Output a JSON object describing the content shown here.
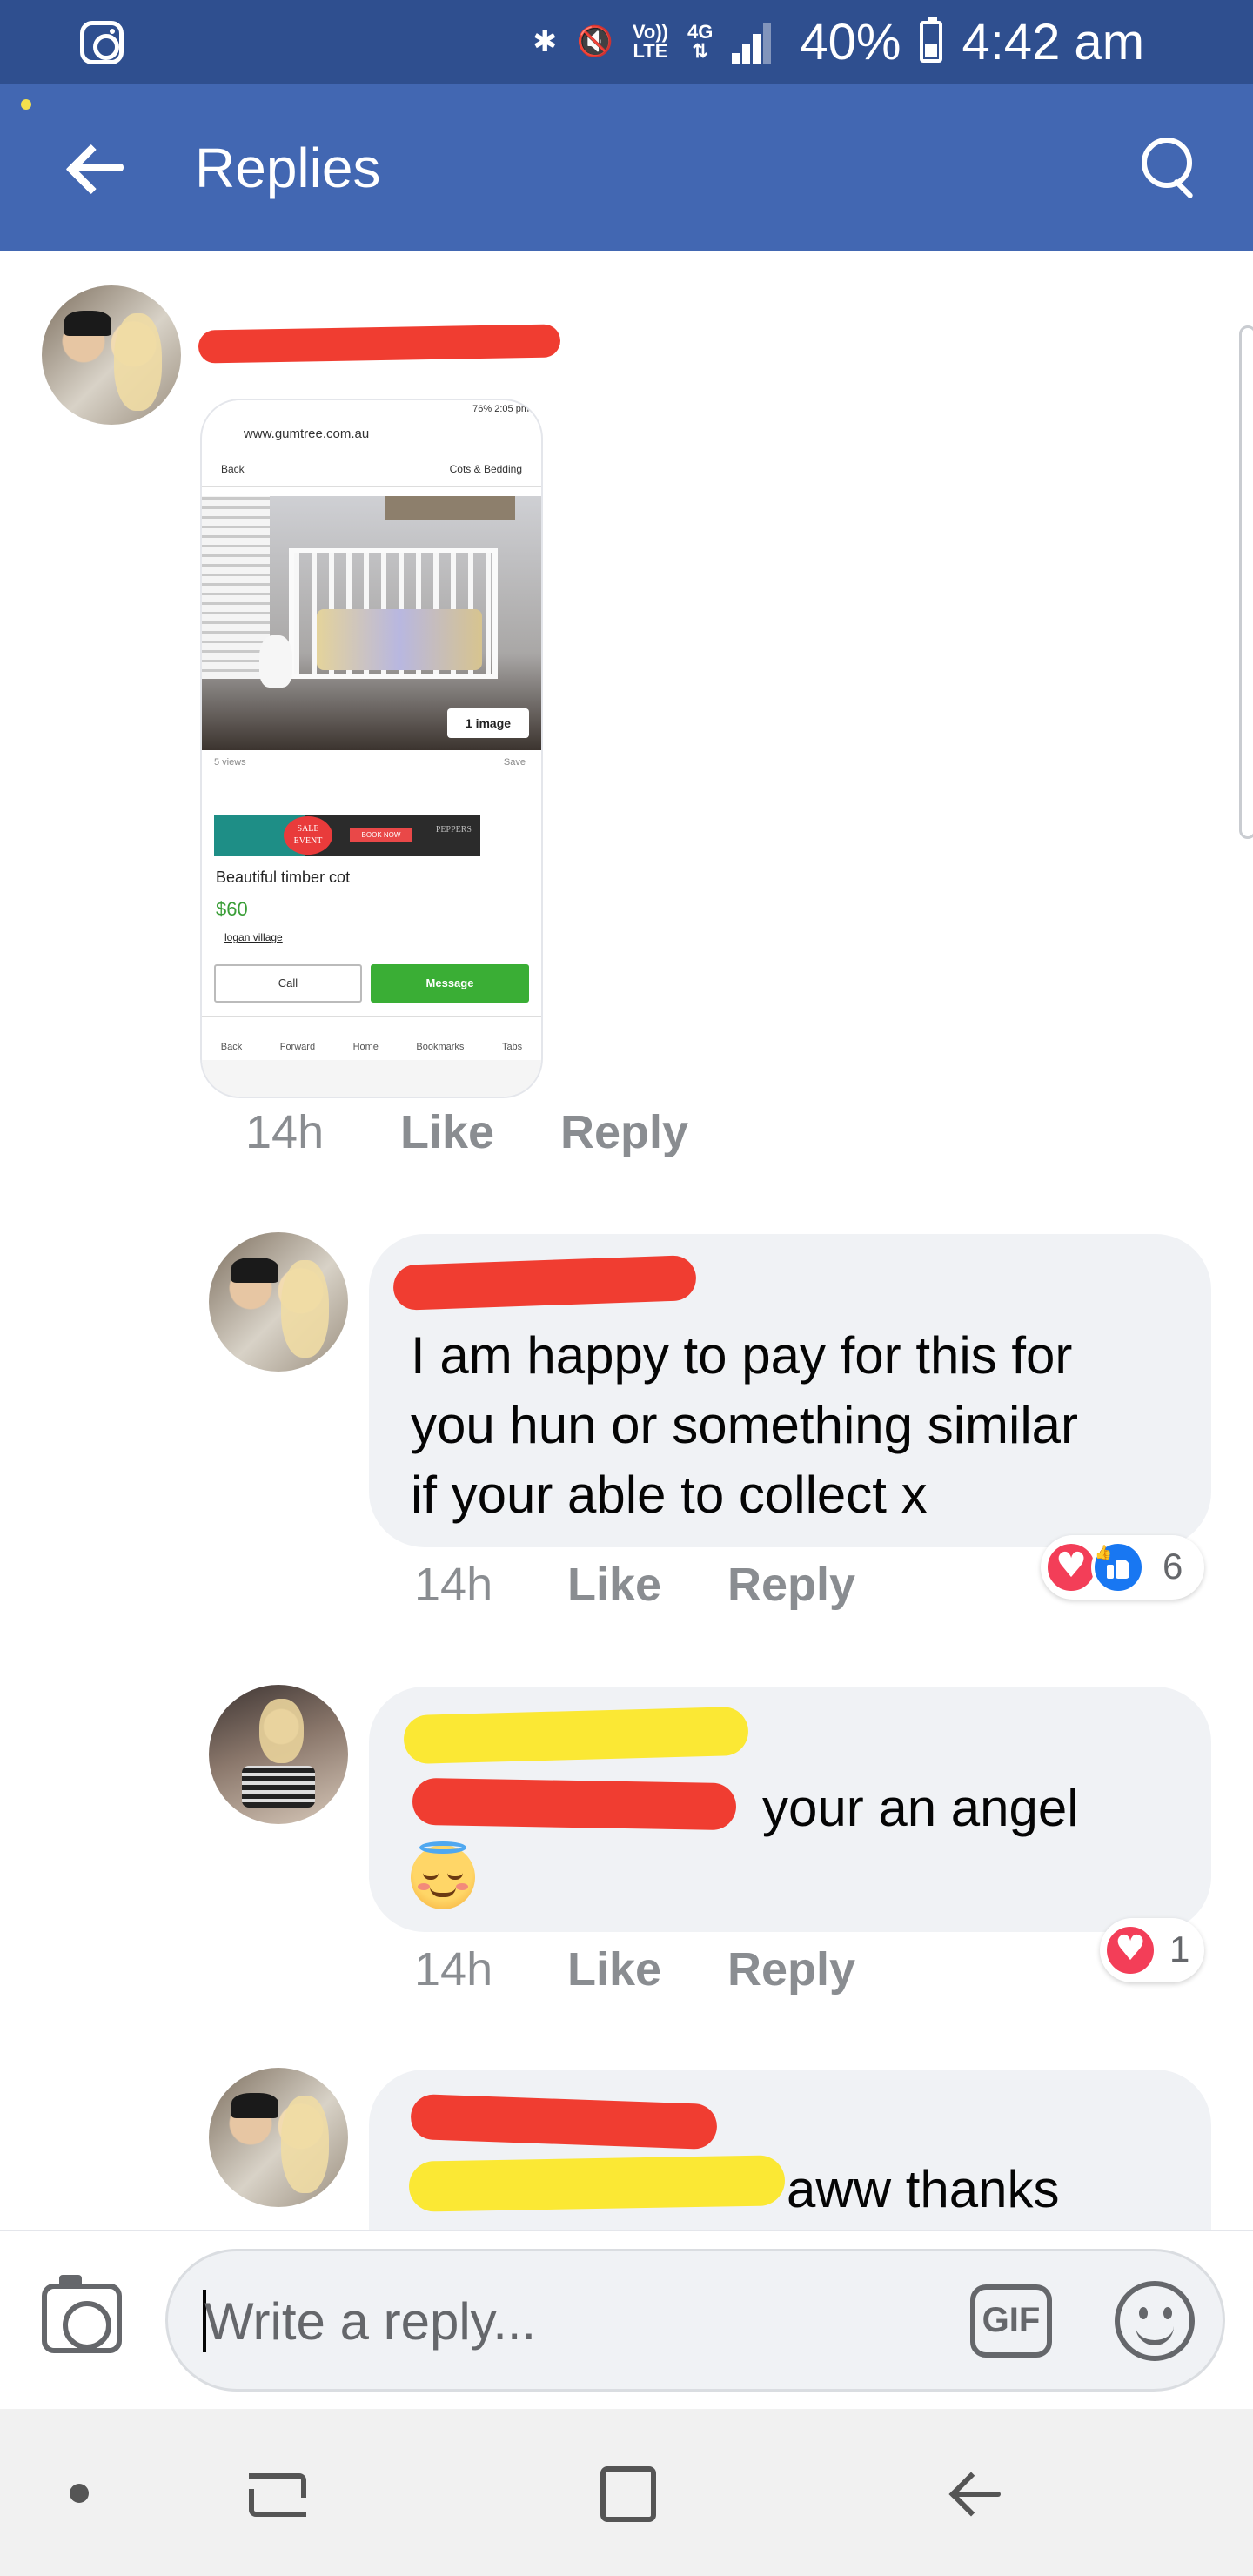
{
  "status_bar": {
    "network_top": "Vo))",
    "network_bottom": "LTE",
    "data_top": "4G",
    "battery_percent": "40%",
    "time": "4:42 am"
  },
  "app_bar": {
    "title": "Replies"
  },
  "comments": [
    {
      "time": "14h",
      "like_label": "Like",
      "reply_label": "Reply",
      "image": {
        "url": "www.gumtree.com.au",
        "back": "Back",
        "category": "Cots & Bedding",
        "image_badge": "1 image",
        "views": "5 views",
        "save": "Save",
        "ad_sale": "SALE EVENT",
        "ad_book": "BOOK NOW",
        "ad_brand": "PEPPERS",
        "listing_title": "Beautiful timber cot",
        "price": "$60",
        "location": "logan village",
        "call": "Call",
        "message": "Message",
        "nav": [
          "Back",
          "Forward",
          "Home",
          "Bookmarks",
          "Tabs"
        ],
        "status_time": "76% 2:05 pm"
      }
    },
    {
      "text_lines": [
        "I am happy to pay for this for",
        "you hun or something similar",
        "if your able to collect x"
      ],
      "time": "14h",
      "like_label": "Like",
      "reply_label": "Reply",
      "reaction_count": "6"
    },
    {
      "text": "your an angel",
      "time": "14h",
      "like_label": "Like",
      "reply_label": "Reply",
      "reaction_count": "1"
    },
    {
      "text": "aww thanks"
    }
  ],
  "composer": {
    "placeholder": "Write a reply...",
    "gif_label": "GIF"
  },
  "colors": {
    "status_bar": "#2f4f8f",
    "app_bar": "#4267b2",
    "bubble": "#f0f2f5",
    "love": "#f33e58",
    "like": "#1877f2",
    "redaction_red": "#f03d31",
    "redaction_yellow": "#fbe834"
  },
  "icons": [
    "instagram-icon",
    "bluetooth-icon",
    "mute-icon",
    "signal-icon",
    "battery-icon",
    "back-arrow-icon",
    "search-icon",
    "camera-icon",
    "gif-icon",
    "emoji-icon",
    "heart-reaction-icon",
    "like-reaction-icon"
  ]
}
